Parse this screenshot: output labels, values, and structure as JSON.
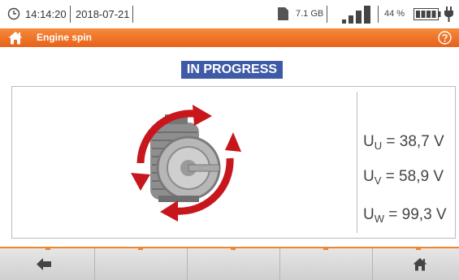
{
  "status": {
    "time": "14:14:20",
    "date": "2018-07-21",
    "storage": "7.1 GB",
    "battery_pct": "44 %",
    "signal_bars": 4
  },
  "titlebar": {
    "title": "Engine spin"
  },
  "badge": "IN PROGRESS",
  "readings": [
    {
      "symbol": "U",
      "sub": "U",
      "value": "= 38,7 V"
    },
    {
      "symbol": "U",
      "sub": "V",
      "value": "= 58,9 V"
    },
    {
      "symbol": "U",
      "sub": "W",
      "value": "= 99,3 V"
    }
  ],
  "icons": {
    "clock": "clock-icon",
    "sd": "sd-card-icon",
    "signal": "signal-icon",
    "battery": "battery-icon",
    "plug": "plug-icon",
    "home": "home-icon",
    "help": "help-icon",
    "back": "back-arrow-icon",
    "motor": "motor-rotation-icon"
  },
  "colors": {
    "accent": "#e8611a",
    "badge": "#3f5ba8",
    "arrow": "#c8161d"
  }
}
